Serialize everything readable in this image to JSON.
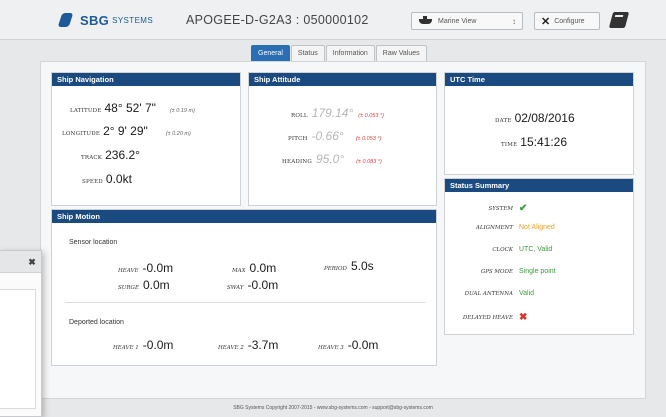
{
  "header": {
    "logo_text": "SBG",
    "logo_sub": "SYSTEMS",
    "device_title": "APOGEE-D-G2A3 : 050000102",
    "view_select_label": "Marine View",
    "configure_label": "Configure"
  },
  "tabs": [
    {
      "label": "General",
      "active": true
    },
    {
      "label": "Status",
      "active": false
    },
    {
      "label": "Information",
      "active": false
    },
    {
      "label": "Raw Values",
      "active": false
    }
  ],
  "ship_navigation": {
    "title": "Ship Navigation",
    "latitude_label": "LATITUDE",
    "latitude_value": "48° 52' 7\"",
    "latitude_acc": "(± 0.19 m)",
    "longitude_label": "LONGITUDE",
    "longitude_value": "2° 9' 29\"",
    "longitude_acc": "(± 0.20 m)",
    "track_label": "TRACK",
    "track_value": "236.2°",
    "speed_label": "SPEED",
    "speed_value": "0.0kt"
  },
  "ship_attitude": {
    "title": "Ship Attitude",
    "roll_label": "ROLL",
    "roll_value": "179.14°",
    "roll_acc": "(± 0.053 °)",
    "pitch_label": "PITCH",
    "pitch_value": "-0.66°",
    "pitch_acc": "(± 0.053 °)",
    "heading_label": "HEADING",
    "heading_value": "95.0°",
    "heading_acc": "(± 0.083 °)"
  },
  "utc_time": {
    "title": "UTC Time",
    "date_label": "DATE",
    "date_value": "02/08/2016",
    "time_label": "TIME",
    "time_value": "15:41:26"
  },
  "status_summary": {
    "title": "Status Summary",
    "system_label": "SYSTEM",
    "alignment_label": "ALIGNMENT",
    "alignment_value": "Not Aligned",
    "clock_label": "CLOCK",
    "clock_value": "UTC, Valid",
    "gps_mode_label": "GPS MODE",
    "gps_mode_value": "Single point",
    "dual_antenna_label": "DUAL ANTENNA",
    "dual_antenna_value": "Valid",
    "delayed_heave_label": "DELAYED HEAVE"
  },
  "ship_motion": {
    "title": "Ship Motion",
    "sensor_location_title": "Sensor location",
    "heave_label": "HEAVE",
    "heave_value": "-0.0m",
    "max_label": "MAX",
    "max_value": "0.0m",
    "period_label": "PERIOD",
    "period_value": "5.0s",
    "surge_label": "SURGE",
    "surge_value": "0.0m",
    "sway_label": "SWAY",
    "sway_value": "-0.0m",
    "deported_location_title": "Deported location",
    "heave1_label": "HEAVE 1",
    "heave1_value": "-0.0m",
    "heave2_label": "HEAVE 2",
    "heave2_value": "-3.7m",
    "heave3_label": "HEAVE 3",
    "heave3_value": "-0.0m"
  },
  "footer": {
    "text": "SBG Systems Copyright 2007-2015 - www.sbg-systems.com - support@sbg-systems.com"
  },
  "colors": {
    "panel_header": "#1b4a80",
    "tab_active": "#2a6fb6",
    "ok": "#3f9a3f",
    "warning": "#f0a020",
    "error": "#e03030"
  }
}
